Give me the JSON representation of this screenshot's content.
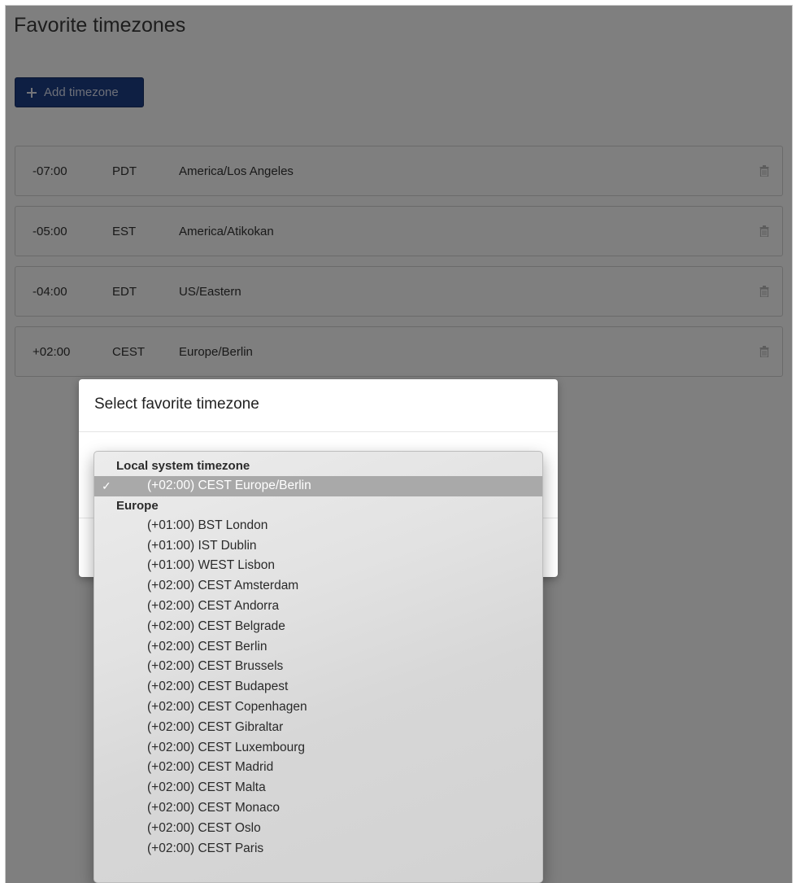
{
  "page": {
    "title": "Favorite timezones",
    "add_button_label": "Add timezone"
  },
  "timezones": [
    {
      "offset": "-07:00",
      "abbr": "PDT",
      "name": "America/Los Angeles"
    },
    {
      "offset": "-05:00",
      "abbr": "EST",
      "name": "America/Atikokan"
    },
    {
      "offset": "-04:00",
      "abbr": "EDT",
      "name": "US/Eastern"
    },
    {
      "offset": "+02:00",
      "abbr": "CEST",
      "name": "Europe/Berlin"
    }
  ],
  "modal": {
    "title": "Select favorite timezone"
  },
  "dropdown": {
    "groups": [
      {
        "label": "Local system timezone",
        "options": [
          {
            "label": "(+02:00) CEST Europe/Berlin",
            "selected": true
          }
        ]
      },
      {
        "label": "Europe",
        "options": [
          {
            "label": "(+01:00) BST London"
          },
          {
            "label": "(+01:00) IST Dublin"
          },
          {
            "label": "(+01:00) WEST Lisbon"
          },
          {
            "label": "(+02:00) CEST Amsterdam"
          },
          {
            "label": "(+02:00) CEST Andorra"
          },
          {
            "label": "(+02:00) CEST Belgrade"
          },
          {
            "label": "(+02:00) CEST Berlin"
          },
          {
            "label": "(+02:00) CEST Brussels"
          },
          {
            "label": "(+02:00) CEST Budapest"
          },
          {
            "label": "(+02:00) CEST Copenhagen"
          },
          {
            "label": "(+02:00) CEST Gibraltar"
          },
          {
            "label": "(+02:00) CEST Luxembourg"
          },
          {
            "label": "(+02:00) CEST Madrid"
          },
          {
            "label": "(+02:00) CEST Malta"
          },
          {
            "label": "(+02:00) CEST Monaco"
          },
          {
            "label": "(+02:00) CEST Oslo"
          },
          {
            "label": "(+02:00) CEST Paris"
          }
        ]
      }
    ]
  },
  "icons": {
    "add": "plus-icon",
    "delete": "trash-icon",
    "selected": "check-icon"
  },
  "colors": {
    "primary_button": "#1d3f86",
    "selected_option_bg": "#a9a9a9"
  }
}
